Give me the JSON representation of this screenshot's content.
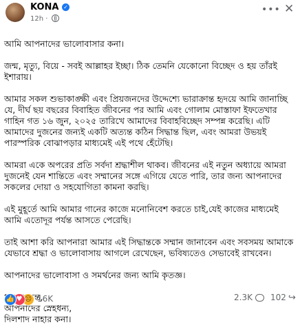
{
  "post": {
    "author": "KONA",
    "time": "12h",
    "dot": "·",
    "paragraphs": [
      "আমি আপনাদের ভালোবাসার কনা।",
      "জন্ম, মৃত্যু, বিয়ে - সবই আল্লাহর ইচ্ছা। ঠিক তেমনি যেকোনো বিচ্ছেদ ও হয় তাঁরই ইশারায়।",
      "আমার সকল শুভাকাঙ্ক্ষী এবং প্রিয়জনদের উদ্দেশ্যে ভারাক্রান্ত হৃদয়ে আমি জানাচ্ছি যে, দীর্ঘ ছয় বছরের বিবাহিত জীবনের পর আমি এবং  গোলাম মোস্তাফা ইফতেখার গাহিন গত ১৬ জুন, ২০২৫ তারিখে আমাদের বিবাহবিচ্ছেদ সম্পন্ন করেছি। এটি আমাদের দুজনের জন্যই একটি অত্যন্ত কঠিন সিদ্ধান্ত ছিল, এবং আমরা উভয়ই পারস্পরিক বোঝাপড়ার মাধ্যমেই এই পথে হেঁটেছি।",
      "আমরা একে অপরের প্রতি সর্বদা শ্রদ্ধাশীল থাকব। জীবনের এই নতুন অধ্যায়ে আমরা দুজনেই যেন শান্তিতে এবং সম্মানের সঙ্গে এগিয়ে যেতে পারি, তার জন্য আপনাদের সকলের দোয়া ও সহযোগিতা কামনা করছি।",
      "এই মুহূর্তে আমি আমার গানের কাজে মনোনিবেশ করতে চাই,যেই কাজের মাধ্যমেই আমি এতোদূর পর্যন্ত আসতে পেরেছি।",
      "তাই আশা করি আপনারা আমার এই সিদ্ধান্তকে সম্মান জানাবেন এবং সবসময় আমাকে যেভাবে শ্রদ্ধা ও ভালোবাসায় আগলে রেখেছেন, ভবিষ্যতেও সেভাবেই রাখবেন।",
      "আপনাদের ভালোবাসা ও সমর্থনের জন্য আমি কৃতজ্ঞ।",
      "ধন্যবাদান্তে,\nআপনাদের স্নেহধন্য,\nদিলশাদ নাহার কনা।"
    ]
  },
  "reactions": {
    "count": "16K",
    "comments": "2.3K",
    "shares": "102",
    "icons": [
      "like-icon",
      "love-icon",
      "sad-icon"
    ]
  },
  "icons": {
    "verified": "verified-badge-icon",
    "privacy": "globe-icon",
    "more": "more-options-icon",
    "close": "close-icon",
    "comment": "comment-icon",
    "share": "share-icon"
  },
  "colors": {
    "accent": "#1877f2",
    "love": "#f33e58",
    "sad": "#f7b125",
    "muted": "#65676b"
  }
}
